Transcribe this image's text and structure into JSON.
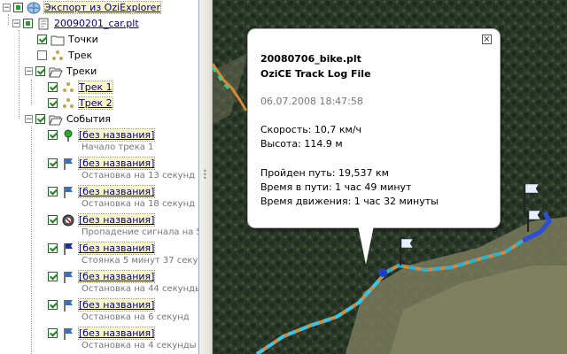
{
  "tree": {
    "root_label": "Экспорт из OziExplorer",
    "file_label": "20090201_car.plt",
    "points_label": "Точки",
    "track_label": "Трек",
    "tracks_label": "Треки",
    "track1_label": "Трек 1",
    "track2_label": "Трек 2",
    "events_label": "События",
    "events": [
      {
        "label": "[без названия]",
        "sub": "Начало трека 1"
      },
      {
        "label": "[без названия]",
        "sub": "Остановка на 13 секунд"
      },
      {
        "label": "[без названия]",
        "sub": "Остановка на 18 секунд"
      },
      {
        "label": "[без названия]",
        "sub": "Пропадение сигнала на 5"
      },
      {
        "label": "[без названия]",
        "sub": "Стоянка 5 минут 37 секун"
      },
      {
        "label": "[без названия]",
        "sub": "Остановка на 44 секунды"
      },
      {
        "label": "[без названия]",
        "sub": "Остановка на 6 секунд"
      },
      {
        "label": "[без названия]",
        "sub": "Остановка на 4 секунды"
      }
    ]
  },
  "balloon": {
    "title": "20080706_bike.plt",
    "subtitle": "OziCE Track Log File",
    "datetime": "06.07.2008 18:47:58",
    "speed": "Скорость: 10,7 км/ч",
    "altitude": "Высота: 114.9 м",
    "distance": "Пройден путь: 19,537 км",
    "time_total": "Время в пути: 1 час 49 минут",
    "time_moving": "Время движения: 1 час 32 минуты"
  }
}
